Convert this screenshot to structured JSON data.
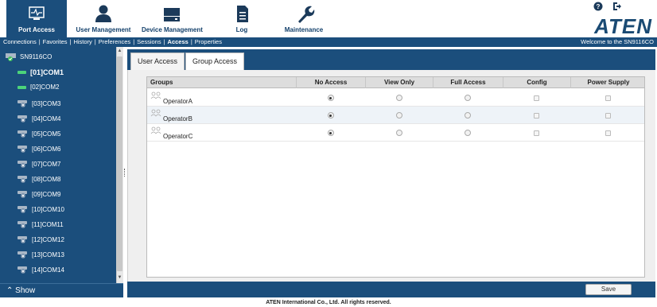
{
  "nav": {
    "items": [
      {
        "label": "Port Access",
        "icon": "port-access-icon"
      },
      {
        "label": "User Management",
        "icon": "user-icon"
      },
      {
        "label": "Device Management",
        "icon": "device-icon"
      },
      {
        "label": "Log",
        "icon": "log-icon"
      },
      {
        "label": "Maintenance",
        "icon": "wrench-icon"
      }
    ],
    "active_index": 0
  },
  "top_icons": [
    "help-icon",
    "logout-icon"
  ],
  "logo_text": "ATEN",
  "submenu": {
    "items": [
      "Connections",
      "Favorites",
      "History",
      "Preferences",
      "Sessions",
      "Access",
      "Properties"
    ],
    "active": "Access",
    "welcome": "Welcome to the SN9116CO"
  },
  "sidebar": {
    "root": "SN9116CO",
    "ports": [
      {
        "label": "[01]COM1",
        "status": "online",
        "selected": true
      },
      {
        "label": "[02]COM2",
        "status": "online",
        "selected": false
      },
      {
        "label": "[03]COM3",
        "status": "offline",
        "selected": false
      },
      {
        "label": "[04]COM4",
        "status": "offline",
        "selected": false
      },
      {
        "label": "[05]COM5",
        "status": "offline",
        "selected": false
      },
      {
        "label": "[06]COM6",
        "status": "offline",
        "selected": false
      },
      {
        "label": "[07]COM7",
        "status": "offline",
        "selected": false
      },
      {
        "label": "[08]COM8",
        "status": "offline",
        "selected": false
      },
      {
        "label": "[09]COM9",
        "status": "offline",
        "selected": false
      },
      {
        "label": "[10]COM10",
        "status": "offline",
        "selected": false
      },
      {
        "label": "[11]COM11",
        "status": "offline",
        "selected": false
      },
      {
        "label": "[12]COM12",
        "status": "offline",
        "selected": false
      },
      {
        "label": "[13]COM13",
        "status": "offline",
        "selected": false
      },
      {
        "label": "[14]COM14",
        "status": "offline",
        "selected": false
      }
    ],
    "show_label": "Show"
  },
  "tabs": {
    "items": [
      "User Access",
      "Group Access"
    ],
    "active_index": 1
  },
  "grid": {
    "columns": [
      "Groups",
      "No Access",
      "View Only",
      "Full Access",
      "Config",
      "Power Supply"
    ],
    "rows": [
      {
        "name": "OperatorA",
        "access": "No Access",
        "config": false,
        "power": false
      },
      {
        "name": "OperatorB",
        "access": "No Access",
        "config": false,
        "power": false
      },
      {
        "name": "OperatorC",
        "access": "No Access",
        "config": false,
        "power": false
      }
    ]
  },
  "save_label": "Save",
  "footer": "ATEN International Co., Ltd. All rights reserved.",
  "colors": {
    "primary": "#1b4e7c",
    "online": "#4cd37a",
    "header_bg": "#dddddd"
  }
}
